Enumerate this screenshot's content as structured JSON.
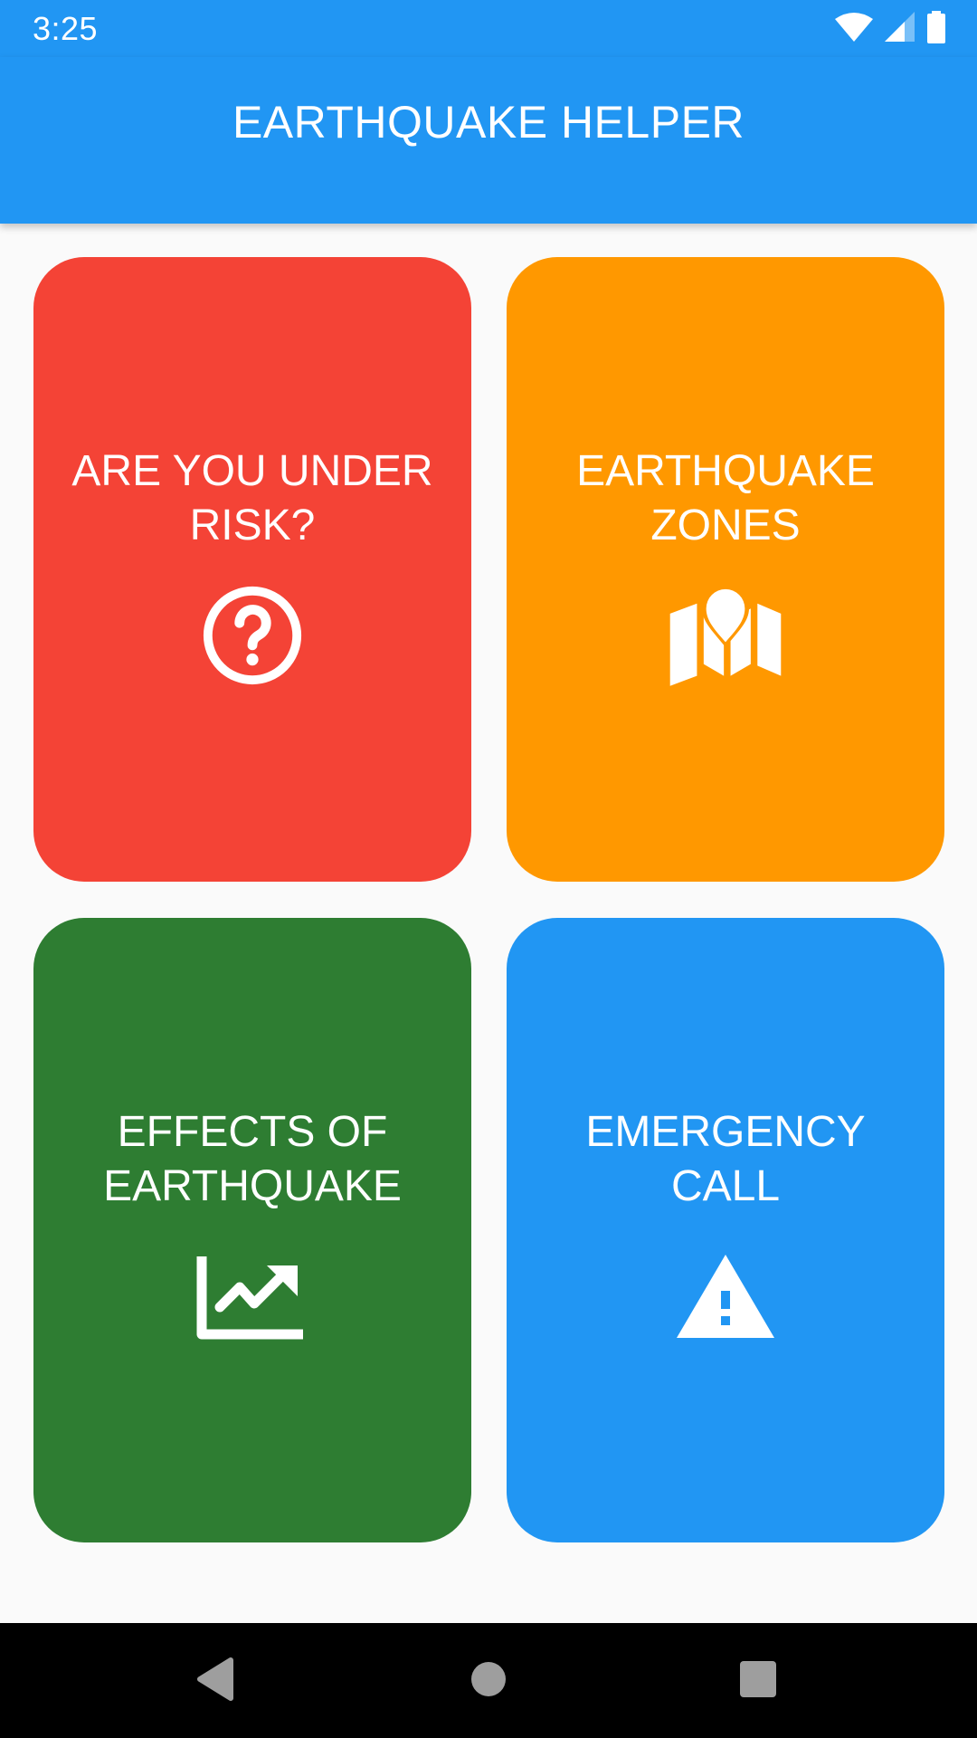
{
  "status_bar": {
    "time": "3:25",
    "icons": [
      "wifi-icon",
      "cellular-signal-icon",
      "battery-icon"
    ]
  },
  "app_bar": {
    "title": "EARTHQUAKE HELPER",
    "color": "#2196F3"
  },
  "cards": [
    {
      "id": "risk",
      "label": "ARE YOU UNDER\nRISK?",
      "icon": "help-circle-icon",
      "color": "#F44336"
    },
    {
      "id": "zones",
      "label": "EARTHQUAKE\nZONES",
      "icon": "map-pin-icon",
      "color": "#FF9800"
    },
    {
      "id": "effects",
      "label": "EFFECTS OF\nEARTHQUAKE",
      "icon": "trending-chart-icon",
      "color": "#2E7D32"
    },
    {
      "id": "emergency",
      "label": "EMERGENCY\nCALL",
      "icon": "warning-icon",
      "color": "#2196F3"
    }
  ],
  "nav_bar": {
    "buttons": [
      "back-icon",
      "home-icon",
      "recents-icon"
    ]
  }
}
